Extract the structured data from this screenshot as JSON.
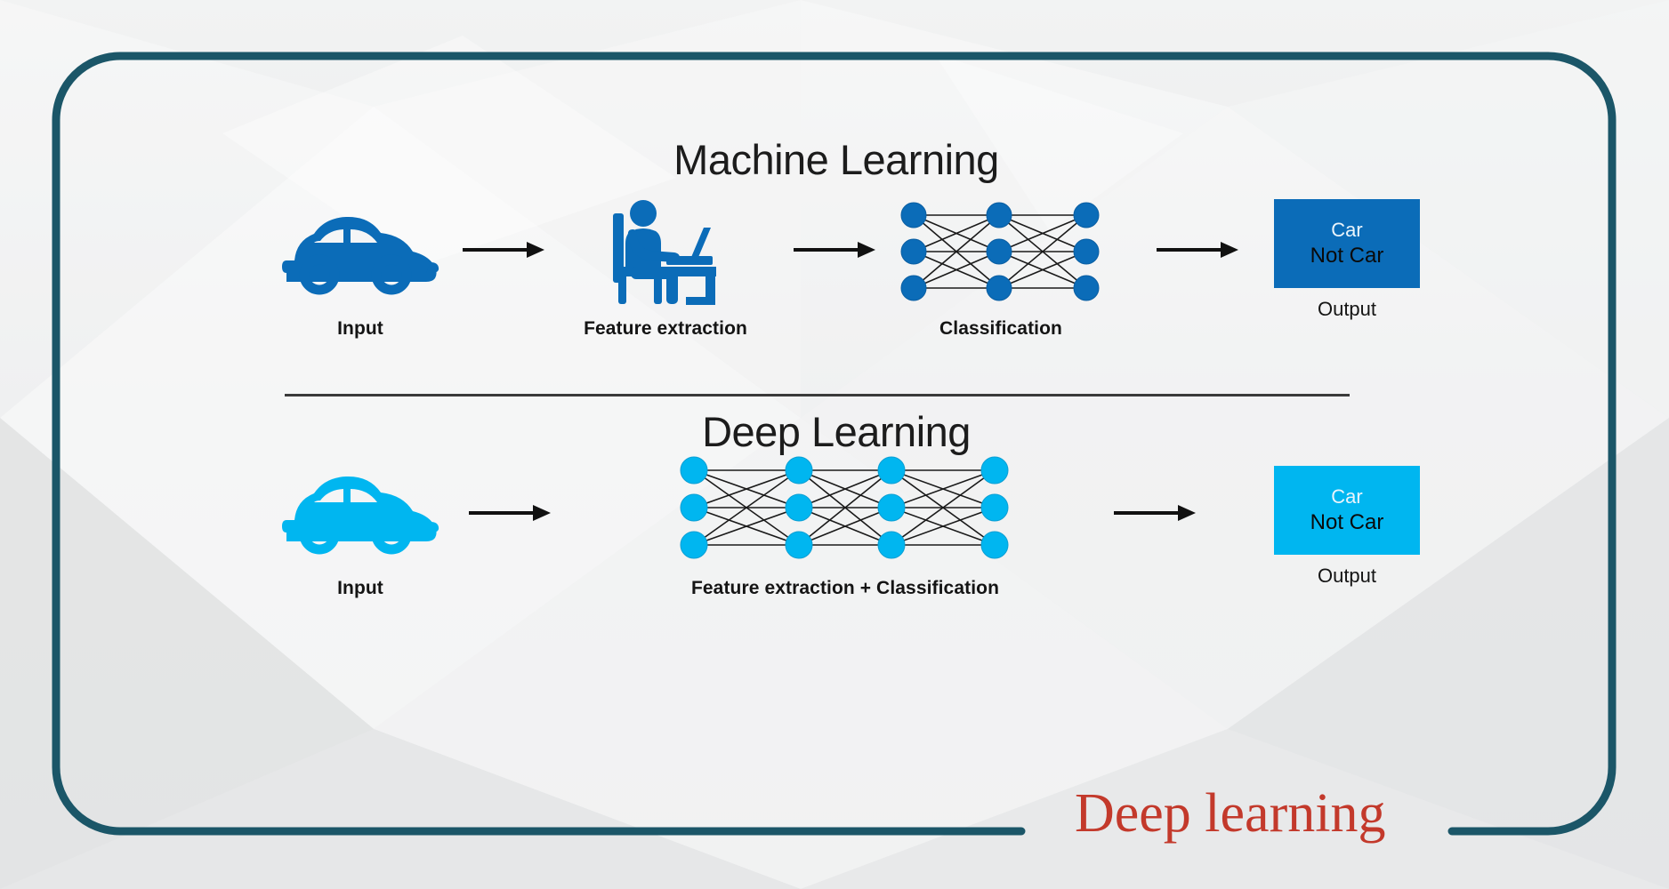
{
  "slide": {
    "frame_color": "#1b5668",
    "background_color": "#eceded"
  },
  "caption": {
    "text": "Deep learning",
    "color": "#c3392b"
  },
  "diagram": {
    "machine_learning": {
      "title": "Machine Learning",
      "accent_color": "#0b6cb8",
      "stages": [
        {
          "label": "Input",
          "icon": "car-icon"
        },
        {
          "label": "Feature extraction",
          "icon": "person-at-laptop-icon"
        },
        {
          "label": "Classification",
          "icon": "neural-network-icon"
        }
      ],
      "network": {
        "layers": 3,
        "nodes_per_layer": 3,
        "node_color": "#0b6cb8"
      },
      "output": {
        "caption": "Output",
        "line1": "Car",
        "line2": "Not Car",
        "box_color": "#0b6cb8"
      },
      "arrows": 3
    },
    "deep_learning": {
      "title": "Deep Learning",
      "accent_color": "#00b6f0",
      "stages": [
        {
          "label": "Input",
          "icon": "car-icon"
        },
        {
          "label": "Feature extraction + Classification",
          "icon": "neural-network-icon"
        }
      ],
      "network": {
        "layers": 4,
        "nodes_per_layer": 3,
        "node_color": "#00b6f0"
      },
      "output": {
        "caption": "Output",
        "line1": "Car",
        "line2": "Not Car",
        "box_color": "#00b6f0"
      },
      "arrows": 2
    }
  }
}
